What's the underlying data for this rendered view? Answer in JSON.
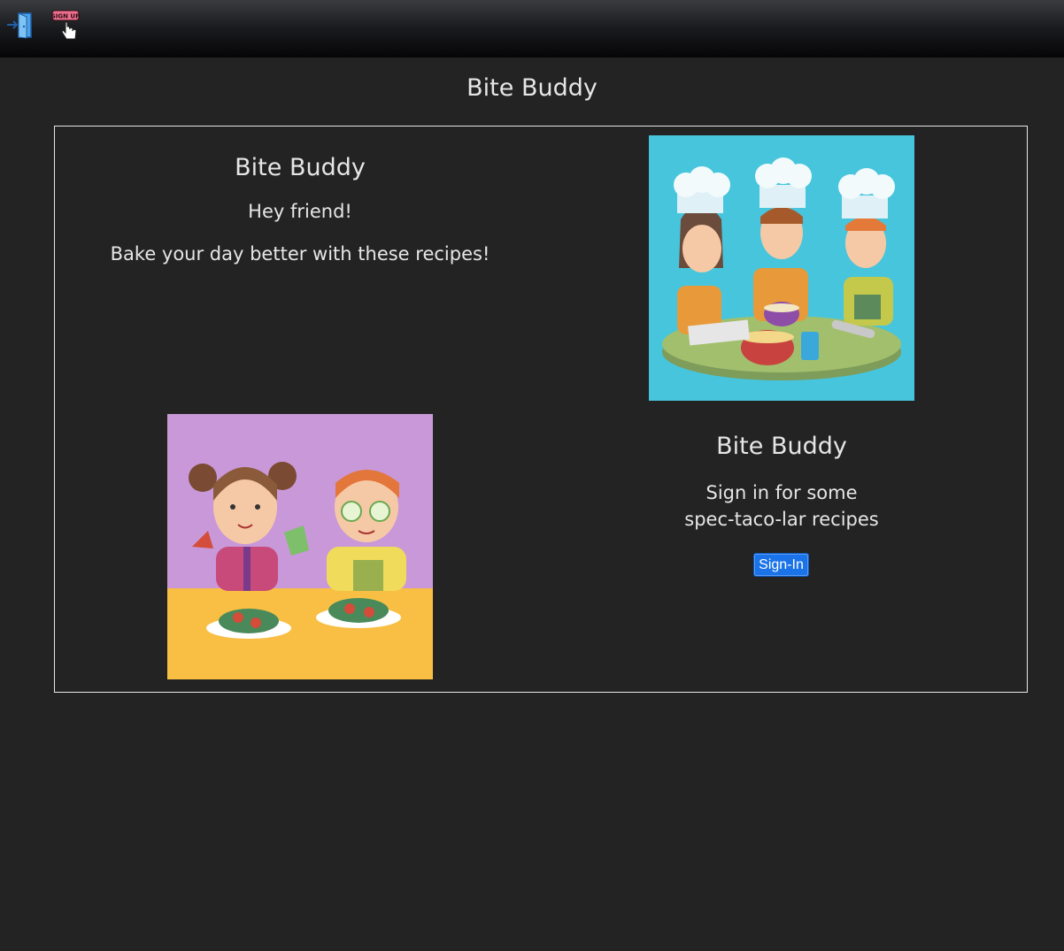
{
  "nav": {
    "login_icon": "login-door-icon",
    "signup_icon": "signup-hand-icon",
    "signup_text": "SIGN UP"
  },
  "page": {
    "title": "Bite Buddy"
  },
  "intro": {
    "heading": "Bite Buddy",
    "greeting": "Hey friend!",
    "tagline": "Bake your day better with these recipes!"
  },
  "signin": {
    "heading": "Bite Buddy",
    "line1": "Sign in for some",
    "line2": "spec-taco-lar recipes",
    "button_label": "Sign-In"
  },
  "images": {
    "chefs": "chefs-baking-illustration",
    "kids": "kids-salad-illustration"
  },
  "colors": {
    "background": "#232323",
    "chefs_bg": "#47c5dc",
    "kids_bg_top": "#c898d8",
    "kids_bg_bottom": "#f8bf44",
    "button": "#1a73e8"
  }
}
